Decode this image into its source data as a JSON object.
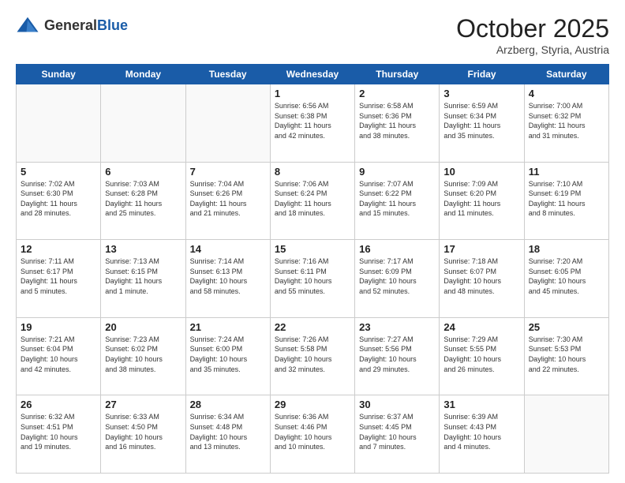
{
  "header": {
    "logo_general": "General",
    "logo_blue": "Blue",
    "month": "October 2025",
    "location": "Arzberg, Styria, Austria"
  },
  "weekdays": [
    "Sunday",
    "Monday",
    "Tuesday",
    "Wednesday",
    "Thursday",
    "Friday",
    "Saturday"
  ],
  "weeks": [
    [
      {
        "day": "",
        "info": ""
      },
      {
        "day": "",
        "info": ""
      },
      {
        "day": "",
        "info": ""
      },
      {
        "day": "1",
        "info": "Sunrise: 6:56 AM\nSunset: 6:38 PM\nDaylight: 11 hours\nand 42 minutes."
      },
      {
        "day": "2",
        "info": "Sunrise: 6:58 AM\nSunset: 6:36 PM\nDaylight: 11 hours\nand 38 minutes."
      },
      {
        "day": "3",
        "info": "Sunrise: 6:59 AM\nSunset: 6:34 PM\nDaylight: 11 hours\nand 35 minutes."
      },
      {
        "day": "4",
        "info": "Sunrise: 7:00 AM\nSunset: 6:32 PM\nDaylight: 11 hours\nand 31 minutes."
      }
    ],
    [
      {
        "day": "5",
        "info": "Sunrise: 7:02 AM\nSunset: 6:30 PM\nDaylight: 11 hours\nand 28 minutes."
      },
      {
        "day": "6",
        "info": "Sunrise: 7:03 AM\nSunset: 6:28 PM\nDaylight: 11 hours\nand 25 minutes."
      },
      {
        "day": "7",
        "info": "Sunrise: 7:04 AM\nSunset: 6:26 PM\nDaylight: 11 hours\nand 21 minutes."
      },
      {
        "day": "8",
        "info": "Sunrise: 7:06 AM\nSunset: 6:24 PM\nDaylight: 11 hours\nand 18 minutes."
      },
      {
        "day": "9",
        "info": "Sunrise: 7:07 AM\nSunset: 6:22 PM\nDaylight: 11 hours\nand 15 minutes."
      },
      {
        "day": "10",
        "info": "Sunrise: 7:09 AM\nSunset: 6:20 PM\nDaylight: 11 hours\nand 11 minutes."
      },
      {
        "day": "11",
        "info": "Sunrise: 7:10 AM\nSunset: 6:19 PM\nDaylight: 11 hours\nand 8 minutes."
      }
    ],
    [
      {
        "day": "12",
        "info": "Sunrise: 7:11 AM\nSunset: 6:17 PM\nDaylight: 11 hours\nand 5 minutes."
      },
      {
        "day": "13",
        "info": "Sunrise: 7:13 AM\nSunset: 6:15 PM\nDaylight: 11 hours\nand 1 minute."
      },
      {
        "day": "14",
        "info": "Sunrise: 7:14 AM\nSunset: 6:13 PM\nDaylight: 10 hours\nand 58 minutes."
      },
      {
        "day": "15",
        "info": "Sunrise: 7:16 AM\nSunset: 6:11 PM\nDaylight: 10 hours\nand 55 minutes."
      },
      {
        "day": "16",
        "info": "Sunrise: 7:17 AM\nSunset: 6:09 PM\nDaylight: 10 hours\nand 52 minutes."
      },
      {
        "day": "17",
        "info": "Sunrise: 7:18 AM\nSunset: 6:07 PM\nDaylight: 10 hours\nand 48 minutes."
      },
      {
        "day": "18",
        "info": "Sunrise: 7:20 AM\nSunset: 6:05 PM\nDaylight: 10 hours\nand 45 minutes."
      }
    ],
    [
      {
        "day": "19",
        "info": "Sunrise: 7:21 AM\nSunset: 6:04 PM\nDaylight: 10 hours\nand 42 minutes."
      },
      {
        "day": "20",
        "info": "Sunrise: 7:23 AM\nSunset: 6:02 PM\nDaylight: 10 hours\nand 38 minutes."
      },
      {
        "day": "21",
        "info": "Sunrise: 7:24 AM\nSunset: 6:00 PM\nDaylight: 10 hours\nand 35 minutes."
      },
      {
        "day": "22",
        "info": "Sunrise: 7:26 AM\nSunset: 5:58 PM\nDaylight: 10 hours\nand 32 minutes."
      },
      {
        "day": "23",
        "info": "Sunrise: 7:27 AM\nSunset: 5:56 PM\nDaylight: 10 hours\nand 29 minutes."
      },
      {
        "day": "24",
        "info": "Sunrise: 7:29 AM\nSunset: 5:55 PM\nDaylight: 10 hours\nand 26 minutes."
      },
      {
        "day": "25",
        "info": "Sunrise: 7:30 AM\nSunset: 5:53 PM\nDaylight: 10 hours\nand 22 minutes."
      }
    ],
    [
      {
        "day": "26",
        "info": "Sunrise: 6:32 AM\nSunset: 4:51 PM\nDaylight: 10 hours\nand 19 minutes."
      },
      {
        "day": "27",
        "info": "Sunrise: 6:33 AM\nSunset: 4:50 PM\nDaylight: 10 hours\nand 16 minutes."
      },
      {
        "day": "28",
        "info": "Sunrise: 6:34 AM\nSunset: 4:48 PM\nDaylight: 10 hours\nand 13 minutes."
      },
      {
        "day": "29",
        "info": "Sunrise: 6:36 AM\nSunset: 4:46 PM\nDaylight: 10 hours\nand 10 minutes."
      },
      {
        "day": "30",
        "info": "Sunrise: 6:37 AM\nSunset: 4:45 PM\nDaylight: 10 hours\nand 7 minutes."
      },
      {
        "day": "31",
        "info": "Sunrise: 6:39 AM\nSunset: 4:43 PM\nDaylight: 10 hours\nand 4 minutes."
      },
      {
        "day": "",
        "info": ""
      }
    ]
  ]
}
